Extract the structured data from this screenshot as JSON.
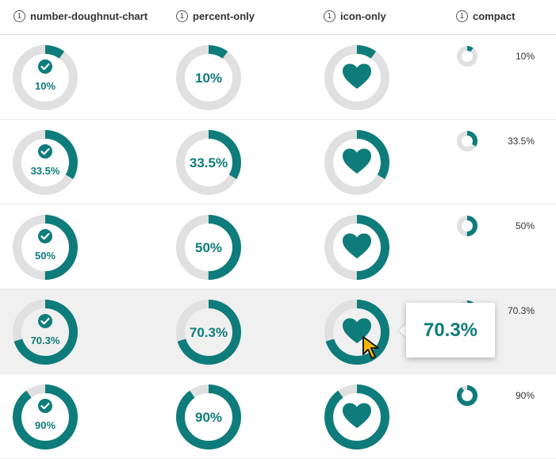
{
  "colors": {
    "accent": "#0e7c7b",
    "track": "#e0e0e0",
    "tooltip_text": "#0e7c7b",
    "cursor": "#f5b800"
  },
  "columns": [
    {
      "label": "number-doughnut-chart",
      "icon": "number-one-icon"
    },
    {
      "label": "percent-only",
      "icon": "number-one-icon"
    },
    {
      "label": "icon-only",
      "icon": "number-one-icon"
    },
    {
      "label": "compact",
      "icon": "number-one-icon"
    }
  ],
  "header_icon_glyph": "1",
  "rows": [
    {
      "percent": 10,
      "label": "10%"
    },
    {
      "percent": 33.5,
      "label": "33.5%"
    },
    {
      "percent": 50,
      "label": "50%"
    },
    {
      "percent": 70.3,
      "label": "70.3%"
    },
    {
      "percent": 90,
      "label": "90%"
    }
  ],
  "hovered_row": 3,
  "tooltip": {
    "value": "70.3%"
  },
  "icons": {
    "check": "check-circle-icon",
    "heart": "heart-icon"
  }
}
